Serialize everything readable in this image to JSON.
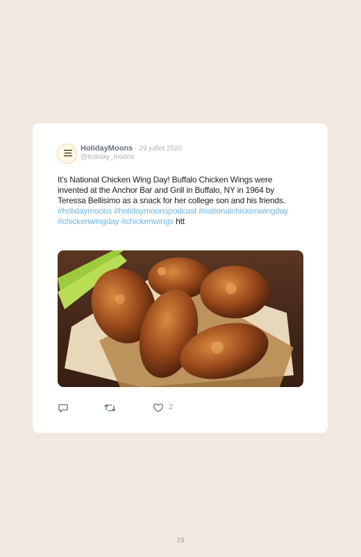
{
  "tweet": {
    "author_name": "HolidayMoons",
    "date": "· 29 juillet 2020",
    "handle": "@holiday_moons",
    "text": "It's National Chicken Wing Day! Buffalo Chicken Wings were invented at the Anchor Bar and Grill in Buffalo, NY in 1964 by Teressa Bellisimo as a snack for her college son and his friends. ",
    "hashtags": [
      "#holidaymoons",
      "#holidaymoonspodcast",
      "#nationalchickenwingday",
      "#chickenwingday",
      "#chickenwings"
    ],
    "text_tail": "htt",
    "image": "chicken-wings-photo",
    "like_count": "2"
  },
  "avatar_logo": "Holiday Moons podcast",
  "page_number": "29",
  "colors": {
    "background": "#f2e8df",
    "card": "#ffffff",
    "hashtag": "#6fb6e2",
    "icon": "#5d6f80"
  },
  "icons": [
    "reply-icon",
    "retweet-icon",
    "like-icon"
  ]
}
